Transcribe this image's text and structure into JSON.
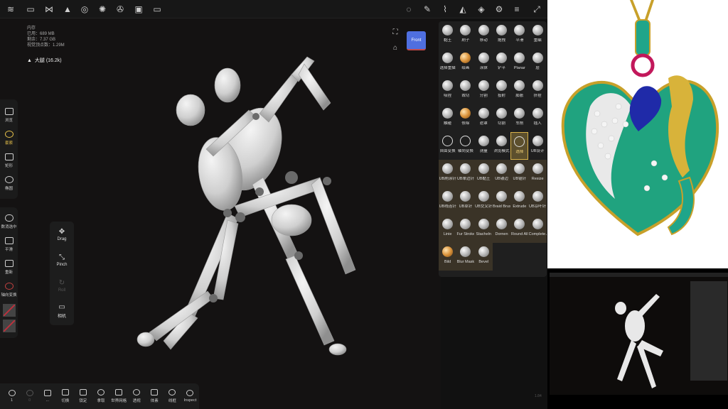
{
  "topbar": {
    "left_icons": [
      "logo-icon",
      "folder-icon",
      "share-icon",
      "layers-stack-icon",
      "globe-icon",
      "sun-icon",
      "aperture-icon",
      "image-icon",
      "video-icon"
    ],
    "right_icons": [
      "lasso-icon",
      "pen-icon",
      "dropper-icon",
      "contrast-icon",
      "stack-icon",
      "gear-icon",
      "sliders-icon",
      "expand-icon"
    ]
  },
  "stats": {
    "heading": "内存",
    "used": "已用：689 MB",
    "free": "剩余：7.37 GB",
    "vertices": "视觉顶点数：1.29M"
  },
  "mesh": {
    "label": "大腿 (16.2k)"
  },
  "view_cube": {
    "label": "Front"
  },
  "left_tools": [
    {
      "label": "浏览",
      "active": false
    },
    {
      "label": "套索",
      "active": true
    },
    {
      "label": "矩形",
      "active": false
    },
    {
      "label": "椭圆",
      "active": false
    }
  ],
  "left_tools2": [
    {
      "label": "数消选中"
    },
    {
      "label": "平滑"
    },
    {
      "label": "重新"
    },
    {
      "label": "轴向变换"
    }
  ],
  "gesture": [
    {
      "label": "Drag",
      "icon": "✥",
      "dim": false
    },
    {
      "label": "Pinch",
      "icon": "⤡",
      "dim": false
    },
    {
      "label": "Roll",
      "icon": "↻",
      "dim": true
    },
    {
      "label": "相机",
      "icon": "▭",
      "dim": false
    }
  ],
  "bottom_toolbar": [
    {
      "label": "1",
      "dim": false
    },
    {
      "label": "0",
      "dim": true
    },
    {
      "label": "...",
      "dim": false
    },
    {
      "label": "切换",
      "dim": false
    },
    {
      "label": "锁定",
      "dim": false
    },
    {
      "label": "拿取",
      "dim": false
    },
    {
      "label": "世界网格",
      "dim": false
    },
    {
      "label": "透视",
      "dim": false
    },
    {
      "label": "体素",
      "dim": false
    },
    {
      "label": "线框",
      "dim": false
    },
    {
      "label": "Inspect",
      "dim": false
    }
  ],
  "brushes": [
    {
      "label": "黏土",
      "style": ""
    },
    {
      "label": "刷子",
      "style": ""
    },
    {
      "label": "移动",
      "style": ""
    },
    {
      "label": "拖拽",
      "style": ""
    },
    {
      "label": "平滑",
      "style": ""
    },
    {
      "label": "重编",
      "style": ""
    },
    {
      "label": "选择重描",
      "style": ""
    },
    {
      "label": "绘画",
      "style": "warm"
    },
    {
      "label": "涂抹",
      "style": ""
    },
    {
      "label": "铲平",
      "style": ""
    },
    {
      "label": "Planar",
      "style": ""
    },
    {
      "label": "层",
      "style": ""
    },
    {
      "label": "吸捏",
      "style": ""
    },
    {
      "label": "裁切",
      "style": ""
    },
    {
      "label": "分割",
      "style": ""
    },
    {
      "label": "投射",
      "style": ""
    },
    {
      "label": "膨胀",
      "style": ""
    },
    {
      "label": "挤捏",
      "style": ""
    },
    {
      "label": "触碰",
      "style": ""
    },
    {
      "label": "修除",
      "style": "warm"
    },
    {
      "label": "遮罩",
      "style": ""
    },
    {
      "label": "切割",
      "style": ""
    },
    {
      "label": "车削",
      "style": ""
    },
    {
      "label": "插入",
      "style": ""
    },
    {
      "label": "自由变换",
      "style": "ring"
    },
    {
      "label": "轴向变换",
      "style": "ring"
    },
    {
      "label": "测量",
      "style": ""
    },
    {
      "label": "浏览模式",
      "style": ""
    },
    {
      "label": "选择",
      "style": "sel"
    },
    {
      "label": "UB设计",
      "style": ""
    },
    {
      "label": "UB刷涂针",
      "style": "tan"
    },
    {
      "label": "UB单边针",
      "style": "tan"
    },
    {
      "label": "UB黏土",
      "style": "tan"
    },
    {
      "label": "UB镂边",
      "style": "tan"
    },
    {
      "label": "UB锯针",
      "style": "tan"
    },
    {
      "label": "Resize",
      "style": "tan"
    },
    {
      "label": "UB线连针",
      "style": "tan"
    },
    {
      "label": "UB草针",
      "style": "tan"
    },
    {
      "label": "UB交叉针",
      "style": "tan"
    },
    {
      "label": "Braid Brush",
      "style": "tan"
    },
    {
      "label": "Extrude",
      "style": "tan"
    },
    {
      "label": "UB凉叶针",
      "style": "tan"
    },
    {
      "label": "Linie",
      "style": "tan"
    },
    {
      "label": "Fur Stroke",
      "style": "tan"
    },
    {
      "label": "Stacheln",
      "style": "tan"
    },
    {
      "label": "Dornen",
      "style": "tan"
    },
    {
      "label": "Round All",
      "style": "tan"
    },
    {
      "label": "Complete Alpha",
      "style": "tan"
    },
    {
      "label": "Bild",
      "style": "tan-warm"
    },
    {
      "label": "Blur Mask",
      "style": "tan"
    },
    {
      "label": "Bevel",
      "style": "tan"
    }
  ],
  "version": "1.84"
}
